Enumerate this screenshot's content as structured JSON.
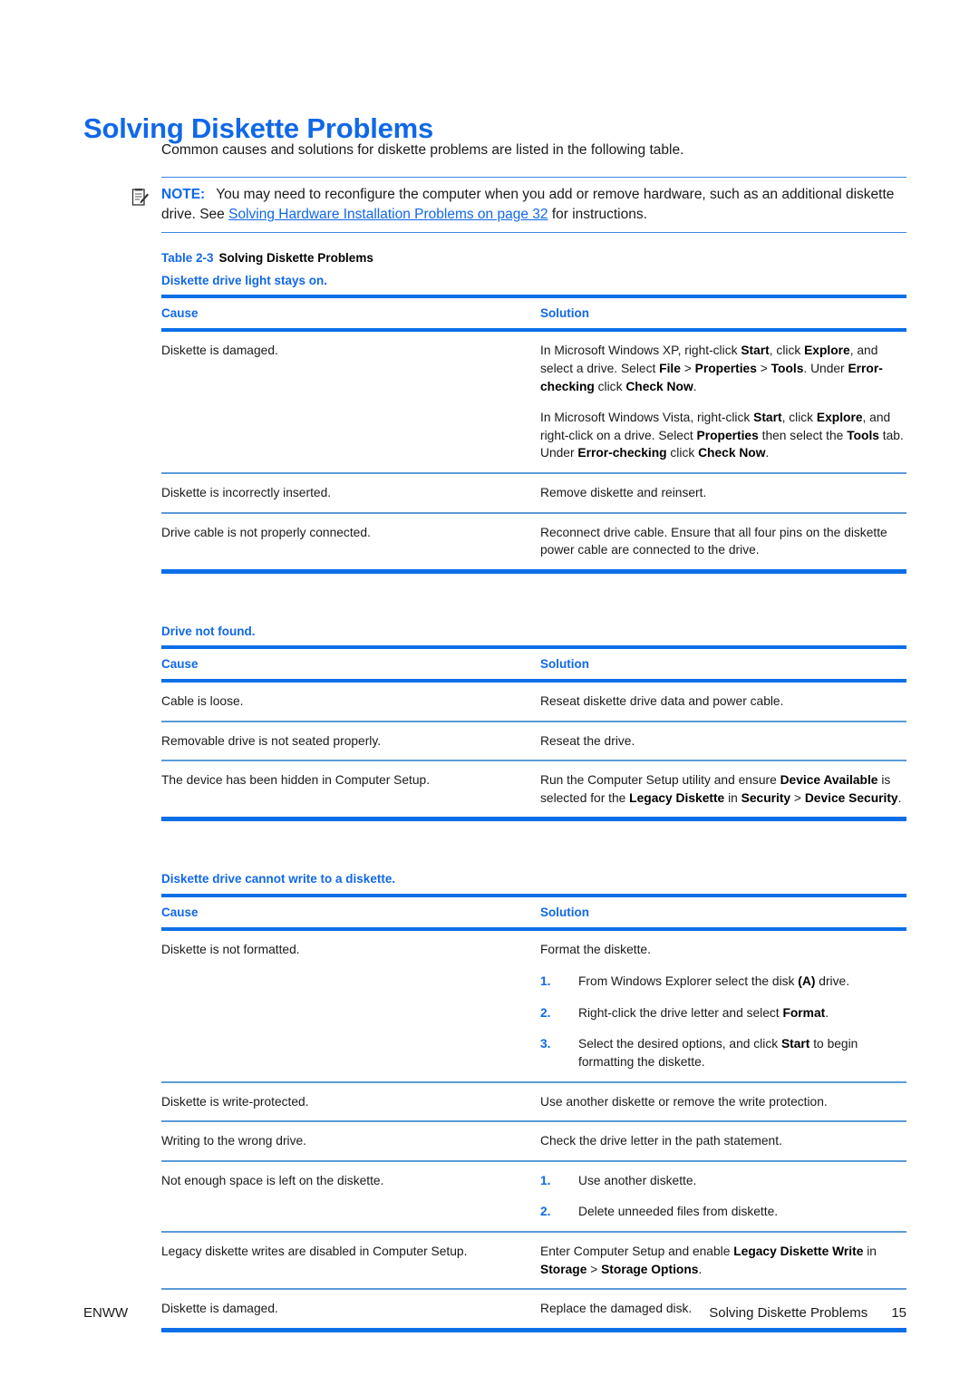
{
  "document": {
    "title": "Solving Diskette Problems",
    "intro": "Common causes and solutions for diskette problems are listed in the following table."
  },
  "note": {
    "icon": "note-clipboard-icon",
    "label": "NOTE:",
    "text_before": "You may need to reconfigure the computer when you add or remove hardware, such as an additional diskette drive. See ",
    "link_text": "Solving Hardware Installation Problems on page 32",
    "text_after": " for instructions."
  },
  "table_caption": {
    "number": "Table 2-3",
    "text": "Solving Diskette Problems"
  },
  "colors": {
    "accent_blue": "#0B6FE8",
    "heading_blue": "#1068E8",
    "rule_light_blue": "#5B9BD8",
    "text_black": "#1a1a1a"
  },
  "columns": {
    "cause": "Cause",
    "solution": "Solution"
  },
  "tables": [
    {
      "subject": "Diskette drive light stays on.",
      "rows": [
        {
          "cause": "Diskette is damaged.",
          "solution_paragraphs": [
            "In Microsoft Windows XP, right-click <b>Start</b>, click <b>Explore</b>, and select a drive. Select <b>File</b> &gt; <b>Properties</b> &gt; <b>Tools</b>. Under <b>Error-checking</b> click <b>Check Now</b>.",
            "In Microsoft Windows Vista, right-click <b>Start</b>, click <b>Explore</b>, and right-click on a drive. Select <b>Properties</b> then select the <b>Tools</b> tab. Under <b>Error-checking</b> click <b>Check Now</b>."
          ],
          "solution_list": []
        },
        {
          "cause": "Diskette is incorrectly inserted.",
          "solution_paragraphs": [
            "Remove diskette and reinsert."
          ],
          "solution_list": []
        },
        {
          "cause": "Drive cable is not properly connected.",
          "solution_paragraphs": [
            "Reconnect drive cable. Ensure that all four pins on the diskette power cable are connected to the drive."
          ],
          "solution_list": []
        }
      ]
    },
    {
      "subject": "Drive not found.",
      "rows": [
        {
          "cause": "Cable is loose.",
          "solution_paragraphs": [
            "Reseat diskette drive data and power cable."
          ],
          "solution_list": []
        },
        {
          "cause": "Removable drive is not seated properly.",
          "solution_paragraphs": [
            "Reseat the drive."
          ],
          "solution_list": []
        },
        {
          "cause": "The device has been hidden in Computer Setup.",
          "solution_paragraphs": [
            "Run the Computer Setup utility and ensure <b>Device Available</b> is selected for the <b>Legacy Diskette</b> in <b>Security</b> &gt; <b>Device Security</b>."
          ],
          "solution_list": []
        }
      ]
    },
    {
      "subject": "Diskette drive cannot write to a diskette.",
      "rows": [
        {
          "cause": "Diskette is not formatted.",
          "solution_paragraphs": [
            "Format the diskette."
          ],
          "solution_list": [
            {
              "num": "1.",
              "text": "From Windows Explorer select the disk <b>(A)</b> drive."
            },
            {
              "num": "2.",
              "text": "Right-click the drive letter and select <b>Format</b>."
            },
            {
              "num": "3.",
              "text": "Select the desired options, and click <b>Start</b> to begin formatting the diskette."
            }
          ]
        },
        {
          "cause": "Diskette is write-protected.",
          "solution_paragraphs": [
            "Use another diskette or remove the write protection."
          ],
          "solution_list": []
        },
        {
          "cause": "Writing to the wrong drive.",
          "solution_paragraphs": [
            "Check the drive letter in the path statement."
          ],
          "solution_list": []
        },
        {
          "cause": "Not enough space is left on the diskette.",
          "solution_paragraphs": [],
          "solution_list": [
            {
              "num": "1.",
              "text": "Use another diskette."
            },
            {
              "num": "2.",
              "text": "Delete unneeded files from diskette."
            }
          ]
        },
        {
          "cause": "Legacy diskette writes are disabled in Computer Setup.",
          "solution_paragraphs": [
            "Enter Computer Setup and enable <b>Legacy Diskette Write</b> in <b>Storage</b> &gt; <b>Storage Options</b>."
          ],
          "solution_list": []
        },
        {
          "cause": "Diskette is damaged.",
          "solution_paragraphs": [
            "Replace the damaged disk."
          ],
          "solution_list": []
        }
      ]
    }
  ],
  "footer": {
    "left": "ENWW",
    "right": "Solving Diskette Problems",
    "page_number": "15"
  }
}
